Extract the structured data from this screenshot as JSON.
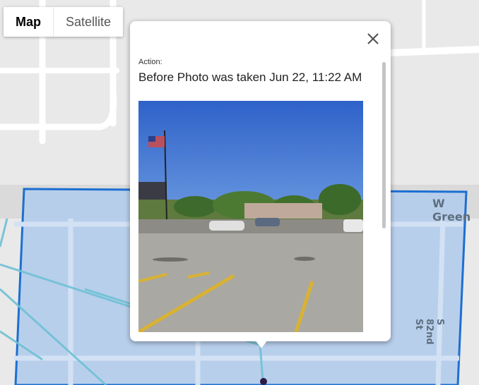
{
  "map_type": {
    "map_label": "Map",
    "satellite_label": "Satellite"
  },
  "streets": {
    "w_green": "W Green",
    "s_82nd": "S 82nd St"
  },
  "popup": {
    "action_label": "Action:",
    "title": "Before Photo was taken Jun 22, 11:22 AM"
  },
  "colors": {
    "polygon_fill": "#b5cdec",
    "polygon_stroke": "#1c6fd1",
    "route": "#6fc1d4",
    "marker": "#2c1a47"
  }
}
